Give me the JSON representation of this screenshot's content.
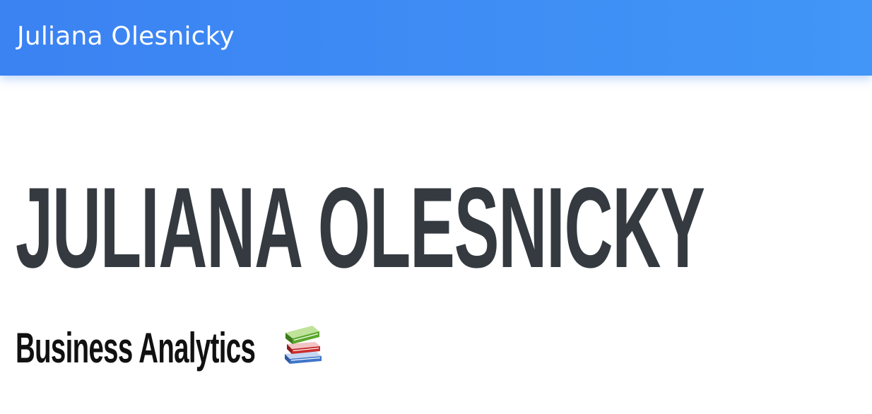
{
  "navbar": {
    "brand": "Juliana Olesnicky",
    "color_start": "#3b82f2",
    "color_end": "#4196f7"
  },
  "hero": {
    "title": "JULIANA OLESNICKY",
    "subtitle": "Business Analytics",
    "subtitle_icon": "books-icon",
    "title_color": "#343a40"
  }
}
